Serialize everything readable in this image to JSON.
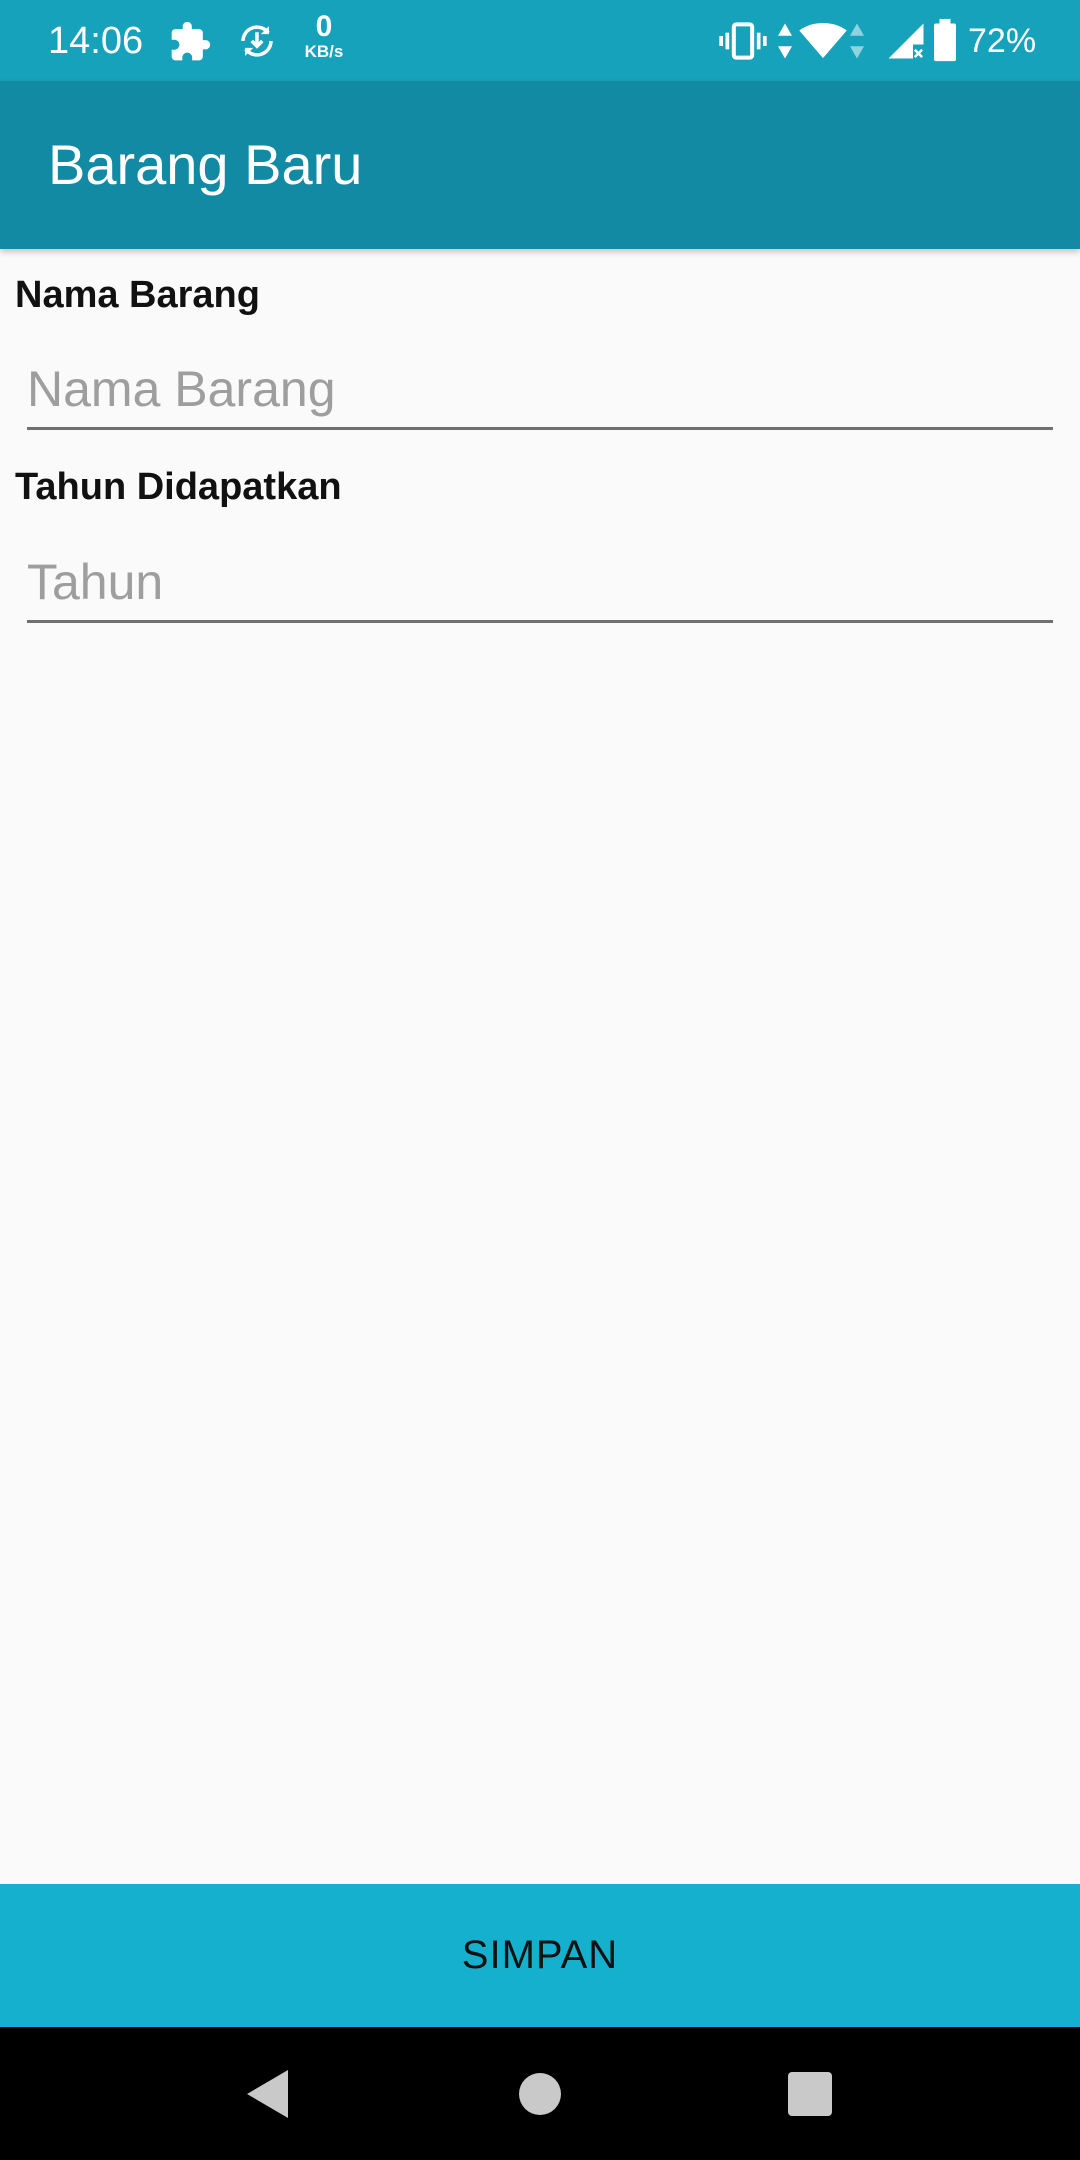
{
  "status_bar": {
    "time": "14:06",
    "netspeed_value": "0",
    "netspeed_unit": "KB/s",
    "battery_percent": "72%",
    "icons": [
      "puzzle-icon",
      "download-sync-icon",
      "vibrate-icon",
      "data-arrows-icon",
      "wifi-icon",
      "signal-icon",
      "battery-icon"
    ]
  },
  "app_bar": {
    "title": "Barang Baru"
  },
  "form": {
    "name_label": "Nama Barang",
    "name_placeholder": "Nama Barang",
    "name_value": "",
    "year_label": "Tahun Didapatkan",
    "year_placeholder": "Tahun",
    "year_value": ""
  },
  "actions": {
    "save_label": "SIMPAN"
  },
  "navigation": {
    "icons": [
      "back-icon",
      "home-icon",
      "recents-icon"
    ]
  },
  "colors": {
    "status_bar": "#17a2bb",
    "app_bar": "#138aa3",
    "button": "#14b0cd",
    "background": "#fafafa"
  }
}
